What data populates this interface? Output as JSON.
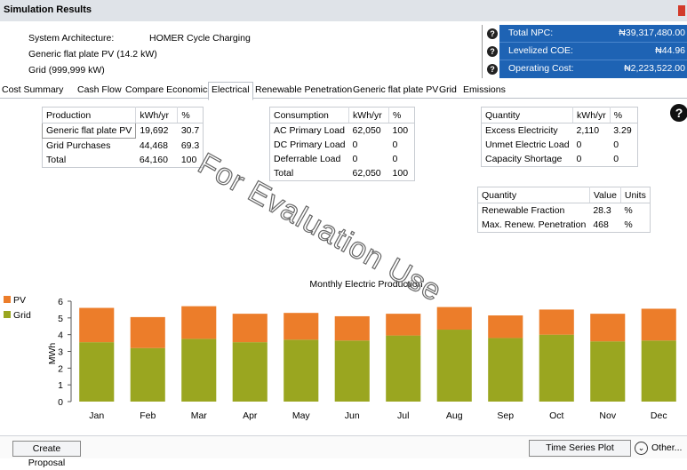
{
  "window": {
    "title": "Simulation Results"
  },
  "summary": {
    "system_architecture_label": "System Architecture:",
    "system_architecture_value": "HOMER Cycle Charging",
    "component_1": "Generic flat plate PV (14.2 kW)",
    "component_2": "Grid (999,999 kW)"
  },
  "costs": {
    "npc_label": "Total NPC:",
    "npc_value": "₦39,317,480.00",
    "coe_label": "Levelized COE:",
    "coe_value": "₦44.96",
    "opex_label": "Operating Cost:",
    "opex_value": "₦2,223,522.00"
  },
  "tabs": [
    "Cost Summary",
    "Cash Flow",
    "Compare Economics",
    "Electrical",
    "Renewable Penetration",
    "Generic flat plate PV",
    "Grid",
    "Emissions"
  ],
  "production_table": {
    "headers": [
      "Production",
      "kWh/yr",
      "%"
    ],
    "rows": [
      [
        "Generic flat plate PV",
        "19,692",
        "30.7"
      ],
      [
        "Grid Purchases",
        "44,468",
        "69.3"
      ],
      [
        "Total",
        "64,160",
        "100"
      ]
    ]
  },
  "consumption_table": {
    "headers": [
      "Consumption",
      "kWh/yr",
      "%"
    ],
    "rows": [
      [
        "AC Primary Load",
        "62,050",
        "100"
      ],
      [
        "DC Primary Load",
        "0",
        "0"
      ],
      [
        "Deferrable Load",
        "0",
        "0"
      ],
      [
        "Total",
        "62,050",
        "100"
      ]
    ]
  },
  "quantity_table": {
    "headers": [
      "Quantity",
      "kWh/yr",
      "%"
    ],
    "rows": [
      [
        "Excess Electricity",
        "2,110",
        "3.29"
      ],
      [
        "Unmet Electric Load",
        "0",
        "0"
      ],
      [
        "Capacity Shortage",
        "0",
        "0"
      ]
    ]
  },
  "renewable_table": {
    "headers": [
      "Quantity",
      "Value",
      "Units"
    ],
    "rows": [
      [
        "Renewable Fraction",
        "28.3",
        "%"
      ],
      [
        "Max. Renew. Penetration",
        "468",
        "%"
      ]
    ]
  },
  "watermark": "For Evaluation Use",
  "chart_data": {
    "type": "bar",
    "stacked": true,
    "title": "Monthly Electric Production",
    "ylabel": "MWh",
    "ylim": [
      0,
      6
    ],
    "yticks": [
      "0",
      "1",
      "2",
      "3",
      "4",
      "5",
      "6"
    ],
    "categories": [
      "Jan",
      "Feb",
      "Mar",
      "Apr",
      "May",
      "Jun",
      "Jul",
      "Aug",
      "Sep",
      "Oct",
      "Nov",
      "Dec"
    ],
    "series": [
      {
        "name": "Grid",
        "color": "#9aa620",
        "values": [
          3.55,
          3.2,
          3.75,
          3.55,
          3.7,
          3.65,
          3.95,
          4.3,
          3.8,
          4.0,
          3.6,
          3.65
        ]
      },
      {
        "name": "PV",
        "color": "#ec7d2a",
        "values": [
          2.05,
          1.85,
          1.95,
          1.7,
          1.6,
          1.45,
          1.3,
          1.35,
          1.35,
          1.5,
          1.65,
          1.9
        ]
      }
    ],
    "legend_position": "top-left",
    "legend_order": [
      "PV",
      "Grid"
    ]
  },
  "footer": {
    "create_proposal": "Create Proposal",
    "time_series": "Time Series Plot",
    "other": "Other..."
  }
}
